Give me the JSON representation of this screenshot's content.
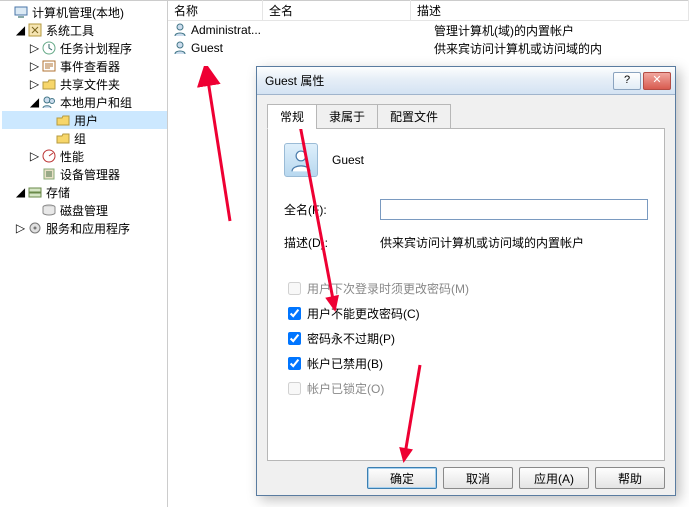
{
  "tree": {
    "root": "计算机管理(本地)",
    "sys_tools": "系统工具",
    "task_sched": "任务计划程序",
    "event_viewer": "事件查看器",
    "shared_folders": "共享文件夹",
    "local_users": "本地用户和组",
    "users": "用户",
    "groups": "组",
    "perf": "性能",
    "devmgr": "设备管理器",
    "storage": "存储",
    "diskmgmt": "磁盘管理",
    "services_apps": "服务和应用程序"
  },
  "list": {
    "headers": {
      "name": "名称",
      "full": "全名",
      "desc": "描述"
    },
    "rows": [
      {
        "name": "Administrat...",
        "full": "",
        "desc": "管理计算机(域)的内置帐户"
      },
      {
        "name": "Guest",
        "full": "",
        "desc": "供来宾访问计算机或访问域的内"
      }
    ]
  },
  "dialog": {
    "title": "Guest 属性",
    "help_glyph": "?",
    "close_glyph": "✕",
    "tabs": {
      "general": "常规",
      "memberof": "隶属于",
      "profile": "配置文件"
    },
    "username": "Guest",
    "fullname_label": "全名(F):",
    "fullname_value": "",
    "desc_label": "描述(D):",
    "desc_value": "供来宾访问计算机或访问域的内置帐户",
    "chk_mustchange": "用户下次登录时须更改密码(M)",
    "chk_cannotchange": "用户不能更改密码(C)",
    "chk_neverexpire": "密码永不过期(P)",
    "chk_disabled": "帐户已禁用(B)",
    "chk_locked": "帐户已锁定(O)",
    "btn_ok": "确定",
    "btn_cancel": "取消",
    "btn_apply": "应用(A)",
    "btn_help": "帮助"
  }
}
